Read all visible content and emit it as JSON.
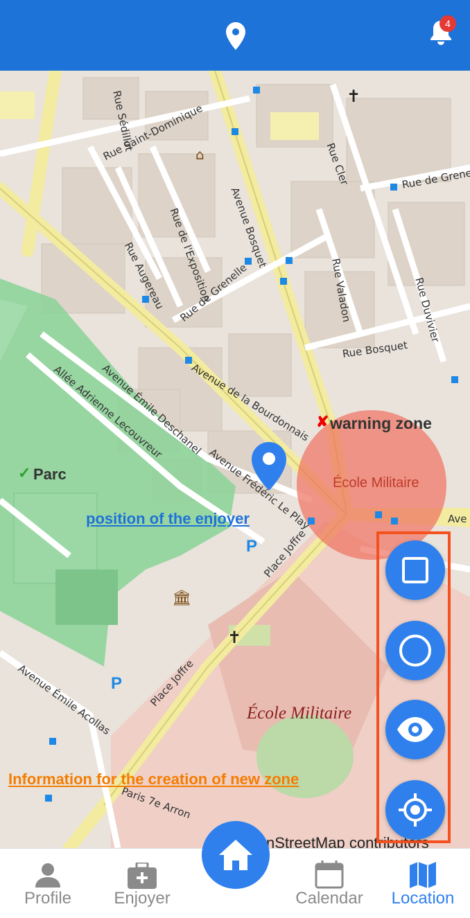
{
  "header": {
    "logo_icon": "map-pin-icon",
    "notification_icon": "bell-icon",
    "notification_count": "4",
    "color": "#1e73d8"
  },
  "map": {
    "annotations": {
      "enjoyer_position": "position of the enjoyer",
      "new_zone_info": "Information for the creation of new zone"
    },
    "warning_zone": {
      "label": "warning zone",
      "marker": "✘",
      "color": "#f07060"
    },
    "safe_zone": {
      "label": "Parc",
      "marker": "✓",
      "color": "#5cc36a"
    },
    "place_labels": {
      "ecole_militaire_big": "École Militaire",
      "ecole_militaire_small": "École Militaire",
      "attribution": "nStreetMap contributors"
    },
    "streets": [
      "Rue Saint-Dominique",
      "Avenue Bosquet",
      "Rue de l'Exposition",
      "Rue Augereau",
      "Rue de Grenelle",
      "Rue Cler",
      "Rue de Grene",
      "Rue Valadon",
      "Rue Duvivier",
      "Rue Bosquet",
      "Avenue de la Bourdonnais",
      "Avenue Émile Deschanel",
      "Allée Adrienne Lecouvreur",
      "Avenue Frédéric Le Play",
      "Place Joffre",
      "Avenue Émile Acollas",
      "Paris 7e Arron",
      "Rue Sédillot",
      "Ave"
    ]
  },
  "zone_tools": [
    {
      "name": "square-zone",
      "icon": "square-icon"
    },
    {
      "name": "circle-zone",
      "icon": "circle-icon"
    },
    {
      "name": "view-zones",
      "icon": "eye-icon"
    },
    {
      "name": "locate",
      "icon": "crosshair-icon"
    }
  ],
  "tabbar": {
    "profile": "Profile",
    "enjoyer": "Enjoyer",
    "home_icon": "home-icon",
    "calendar": "Calendar",
    "location": "Location",
    "active": "Location",
    "active_color": "#2f80ed"
  }
}
